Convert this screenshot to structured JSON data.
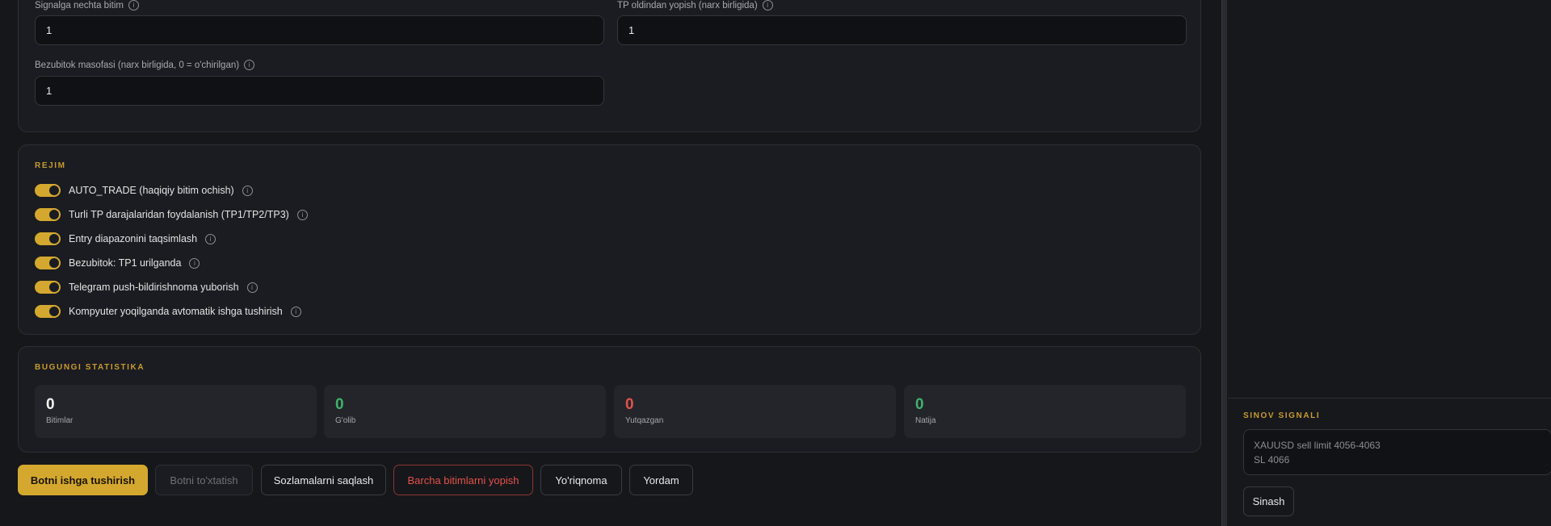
{
  "settings": {
    "fields": [
      {
        "label": "Signalga nechta bitim",
        "value": "1"
      },
      {
        "label": "TP oldindan yopish (narx birligida)",
        "value": "1"
      },
      {
        "label": "Bezubitok masofasi (narx birligida, 0 = o'chirilgan)",
        "value": "1"
      }
    ],
    "info_glyph": "i"
  },
  "mode": {
    "title": "REJIM",
    "toggles": [
      {
        "label": "AUTO_TRADE (haqiqiy bitim ochish)",
        "on": true
      },
      {
        "label": "Turli TP darajalaridan foydalanish (TP1/TP2/TP3)",
        "on": true
      },
      {
        "label": "Entry diapazonini taqsimlash",
        "on": true
      },
      {
        "label": "Bezubitok: TP1 urilganda",
        "on": true
      },
      {
        "label": "Telegram push-bildirishnoma yuborish",
        "on": true
      },
      {
        "label": "Kompyuter yoqilganda avtomatik ishga tushirish",
        "on": true
      }
    ]
  },
  "stats": {
    "title": "BUGUNGI STATISTIKA",
    "items": [
      {
        "value": "0",
        "label": "Bitimlar",
        "color": "#f2f2f4"
      },
      {
        "value": "0",
        "label": "G'olib",
        "color": "#3fb36b"
      },
      {
        "value": "0",
        "label": "Yutqazgan",
        "color": "#e2524a"
      },
      {
        "value": "0",
        "label": "Natija",
        "color": "#3fb36b"
      }
    ]
  },
  "actions": {
    "start": "Botni ishga tushirish",
    "stop": "Botni to'xtatish",
    "save": "Sozlamalarni saqlash",
    "close_all": "Barcha bitimlarni yopish",
    "guide": "Yo'riqnoma",
    "help": "Yordam"
  },
  "test_signal": {
    "title": "SINOV SIGNALI",
    "text": "XAUUSD sell limit 4056-4063\nSL 4066",
    "button": "Sinash"
  },
  "colors": {
    "accent": "#d4a82f",
    "win": "#3fb36b",
    "loss": "#e2524a"
  }
}
